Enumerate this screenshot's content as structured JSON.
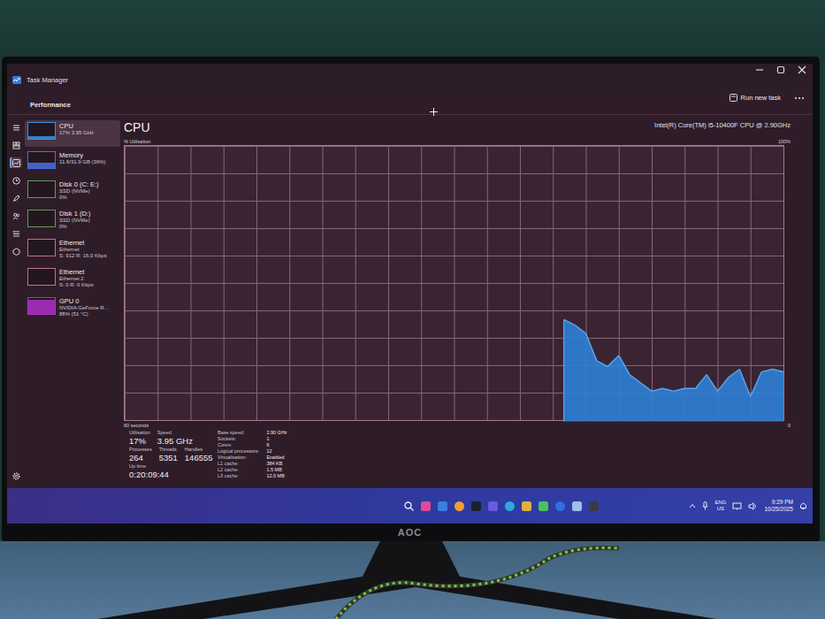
{
  "window": {
    "title": "Task Manager"
  },
  "toolbar": {
    "page": "Performance",
    "action": "Run new task"
  },
  "nav_items": [
    {
      "selected": false
    },
    {
      "selected": false
    },
    {
      "selected": true
    },
    {
      "selected": false
    },
    {
      "selected": false
    },
    {
      "selected": false
    },
    {
      "selected": false
    },
    {
      "selected": false
    }
  ],
  "sidebar": {
    "items": [
      {
        "name": "CPU",
        "lines": [
          "17% 3.95 GHz"
        ],
        "level": 0.17,
        "color": "#3d8fe0",
        "selected": true
      },
      {
        "name": "Memory",
        "lines": [
          "11.6/31.9 GB (36%)"
        ],
        "level": 0.36,
        "color": "#4a6fe0",
        "selected": false
      },
      {
        "name": "Disk 0 (C: E:)",
        "lines": [
          "SSD (NVMe)",
          "0%"
        ],
        "level": 0,
        "color": "#5f9a5a",
        "selected": false
      },
      {
        "name": "Disk 1 (D:)",
        "lines": [
          "SSD (NVMe)",
          "0%"
        ],
        "level": 0,
        "color": "#5f9a5a",
        "selected": false
      },
      {
        "name": "Ethernet",
        "lines": [
          "Ethernet",
          "S: 912 R: 16.0 Kbps"
        ],
        "level": 0,
        "color": "#c0708f",
        "selected": false
      },
      {
        "name": "Ethernet",
        "lines": [
          "Ethernet 2",
          "S: 0 R: 0 Kbps"
        ],
        "level": 0,
        "color": "#c0708f",
        "selected": false
      },
      {
        "name": "GPU 0",
        "lines": [
          "NVIDIA GeForce R…",
          "88% (51 °C)"
        ],
        "level": 0.88,
        "color": "#b030c8",
        "selected": false
      }
    ]
  },
  "header": {
    "title": "CPU",
    "model": "Intel(R) Core(TM) i5-10400F CPU @ 2.90GHz"
  },
  "chart": {
    "y_label": "% Utilisation",
    "y_max": "100%",
    "x_start": "60 seconds",
    "x_end": "0",
    "series": [
      {
        "name": "CPU",
        "values": [
          37,
          35,
          32,
          22,
          20,
          24,
          17,
          14,
          11,
          12,
          11,
          12,
          12,
          17,
          11,
          16,
          19,
          9,
          18,
          19,
          18
        ]
      }
    ]
  },
  "stats": {
    "primary": [
      {
        "label": "Utilisation",
        "value": "17%"
      },
      {
        "label": "Speed",
        "value": "3.95 GHz"
      }
    ],
    "secondary": [
      {
        "label": "Processes",
        "value": "264"
      },
      {
        "label": "Threads",
        "value": "5351"
      },
      {
        "label": "Handles",
        "value": "146555"
      }
    ],
    "uptime": {
      "label": "Up time",
      "value": "0:20:09:44"
    },
    "specs": [
      {
        "label": "Base speed:",
        "value": "2.90 GHz"
      },
      {
        "label": "Sockets:",
        "value": "1"
      },
      {
        "label": "Cores:",
        "value": "6"
      },
      {
        "label": "Logical processors:",
        "value": "12"
      },
      {
        "label": "Virtualisation:",
        "value": "Enabled"
      },
      {
        "label": "L1 cache:",
        "value": "384 KB"
      },
      {
        "label": "L2 cache:",
        "value": "1.5 MB"
      },
      {
        "label": "L3 cache:",
        "value": "12.0 MB"
      }
    ]
  },
  "taskbar": {
    "language": "ENG",
    "region": "US",
    "time": "9:29 PM",
    "date": "10/25/2025"
  },
  "monitor": {
    "brand": "AOC"
  }
}
